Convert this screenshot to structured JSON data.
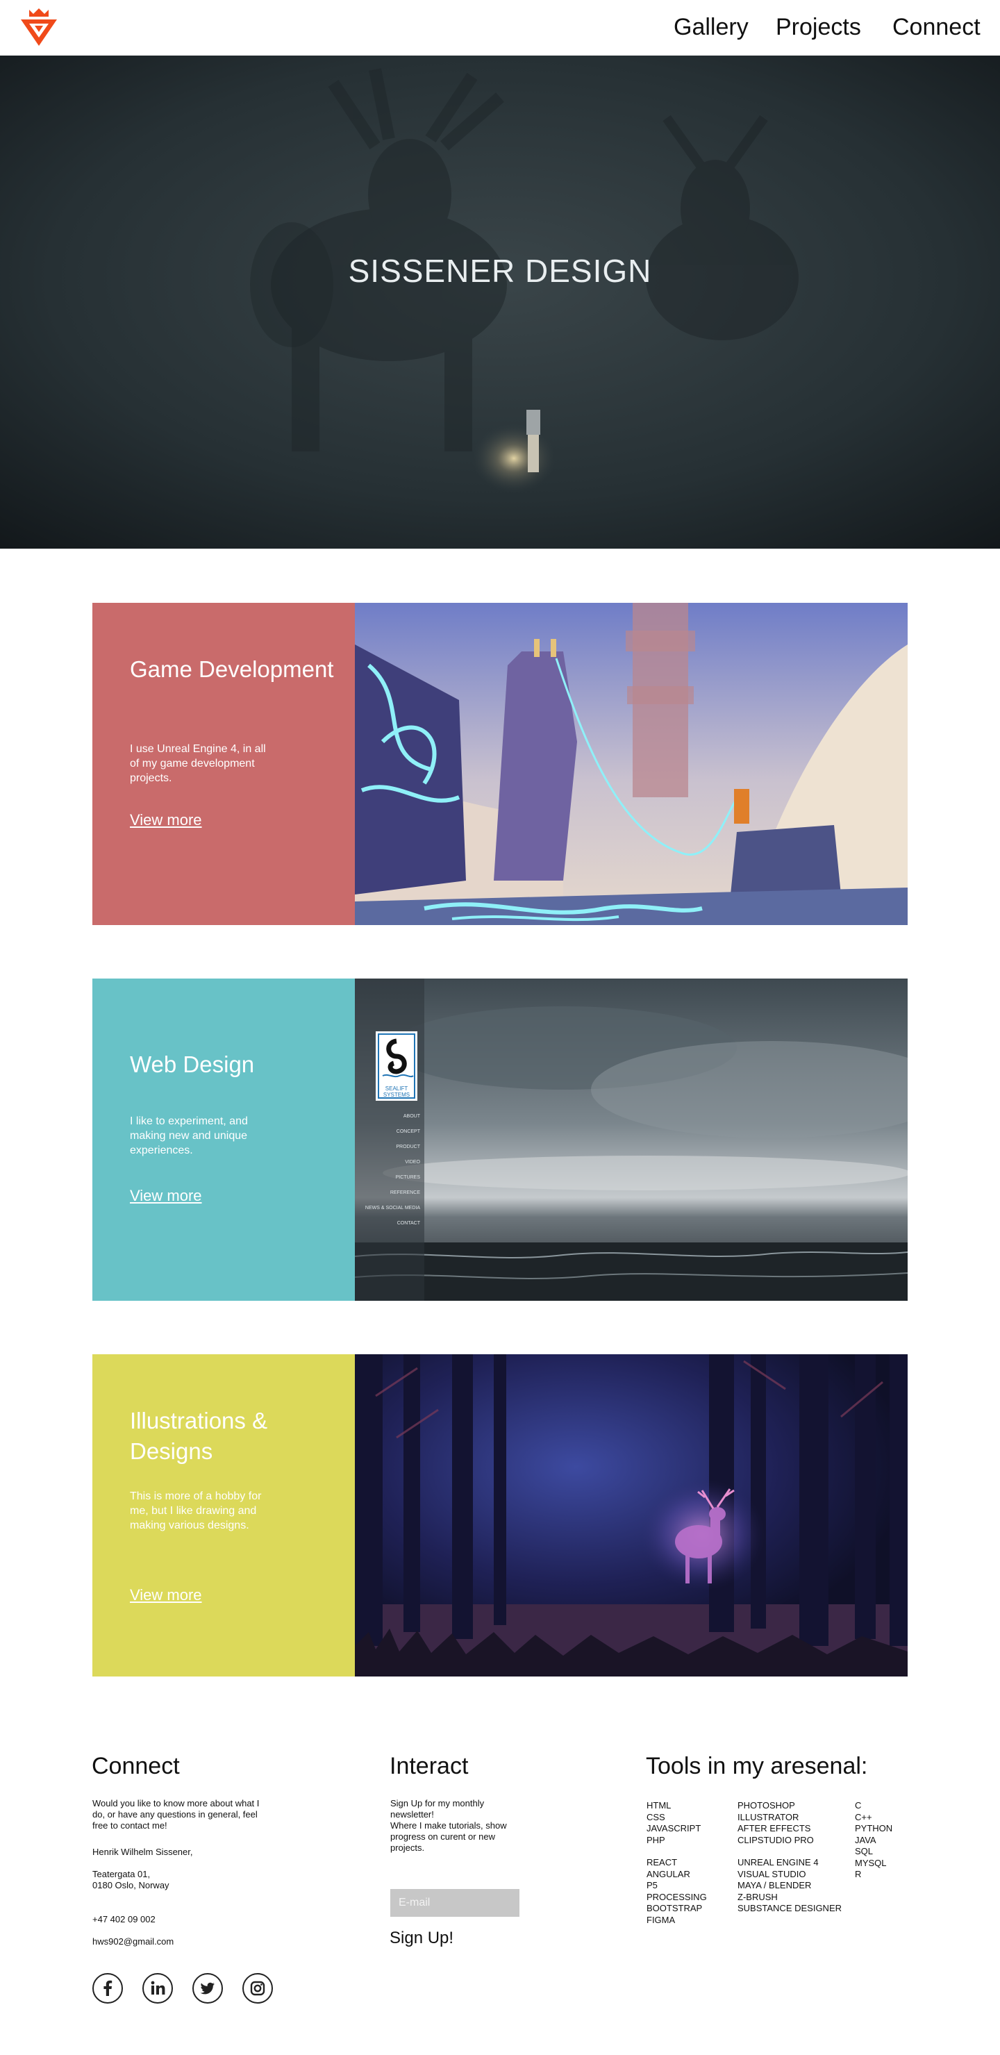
{
  "nav": {
    "links": [
      "Gallery",
      "Projects",
      "Connect"
    ]
  },
  "hero": {
    "title": "SISSENER DESIGN"
  },
  "cards": [
    {
      "title": "Game Development",
      "text": "I use Unreal Engine 4, in all of my game development projects.",
      "link": "View more",
      "color": "#c96b6b"
    },
    {
      "title": "Web Design",
      "text": "I like to experiment, and making new and unique experiences.",
      "link": "View more",
      "color": "#68c2c7",
      "mockup": {
        "brand": "SEALIFT SYSTEMS",
        "menu": [
          "ABOUT",
          "CONCEPT",
          "PRODUCT",
          "VIDEO",
          "PICTURES",
          "REFERENCE",
          "NEWS & SOCIAL MEDIA",
          "CONTACT"
        ]
      }
    },
    {
      "title": "Illustrations & Designs",
      "text": "This is more of a hobby for me, but I like drawing and making various designs.",
      "link": "View more",
      "color": "#dcd95a"
    }
  ],
  "footer": {
    "connect": {
      "heading": "Connect",
      "intro": "Would you like to know more about what I do, or have any questions in general, feel free to contact me!",
      "name": "Henrik Wilhelm Sissener,",
      "address1": "Teatergata 01,",
      "address2": "0180 Oslo, Norway",
      "phone": "+47 402 09 002",
      "email": "hws902@gmail.com",
      "socials": [
        "facebook-icon",
        "linkedin-icon",
        "twitter-icon",
        "instagram-icon"
      ]
    },
    "interact": {
      "heading": "Interact",
      "text1": "Sign Up for my monthly newsletter!",
      "text2": "Where I make tutorials, show progress on curent or new projects.",
      "email_placeholder": "E-mail",
      "signup_label": "Sign Up!"
    },
    "tools": {
      "heading": "Tools in my aresenal:",
      "col1a": [
        "HTML",
        "CSS",
        "JAVASCRIPT",
        "PHP"
      ],
      "col1b": [
        "REACT",
        "ANGULAR",
        "P5",
        "PROCESSING",
        "BOOTSTRAP",
        "FIGMA"
      ],
      "col2a": [
        "PHOTOSHOP",
        "ILLUSTRATOR",
        "AFTER EFFECTS",
        "CLIPSTUDIO PRO"
      ],
      "col2b": [
        "UNREAL ENGINE 4",
        "VISUAL STUDIO",
        "MAYA / BLENDER",
        "Z-BRUSH",
        "SUBSTANCE DESIGNER"
      ],
      "col3": [
        "C",
        "C++",
        "PYTHON",
        "JAVA",
        "SQL",
        "MYSQL",
        "R"
      ]
    }
  }
}
